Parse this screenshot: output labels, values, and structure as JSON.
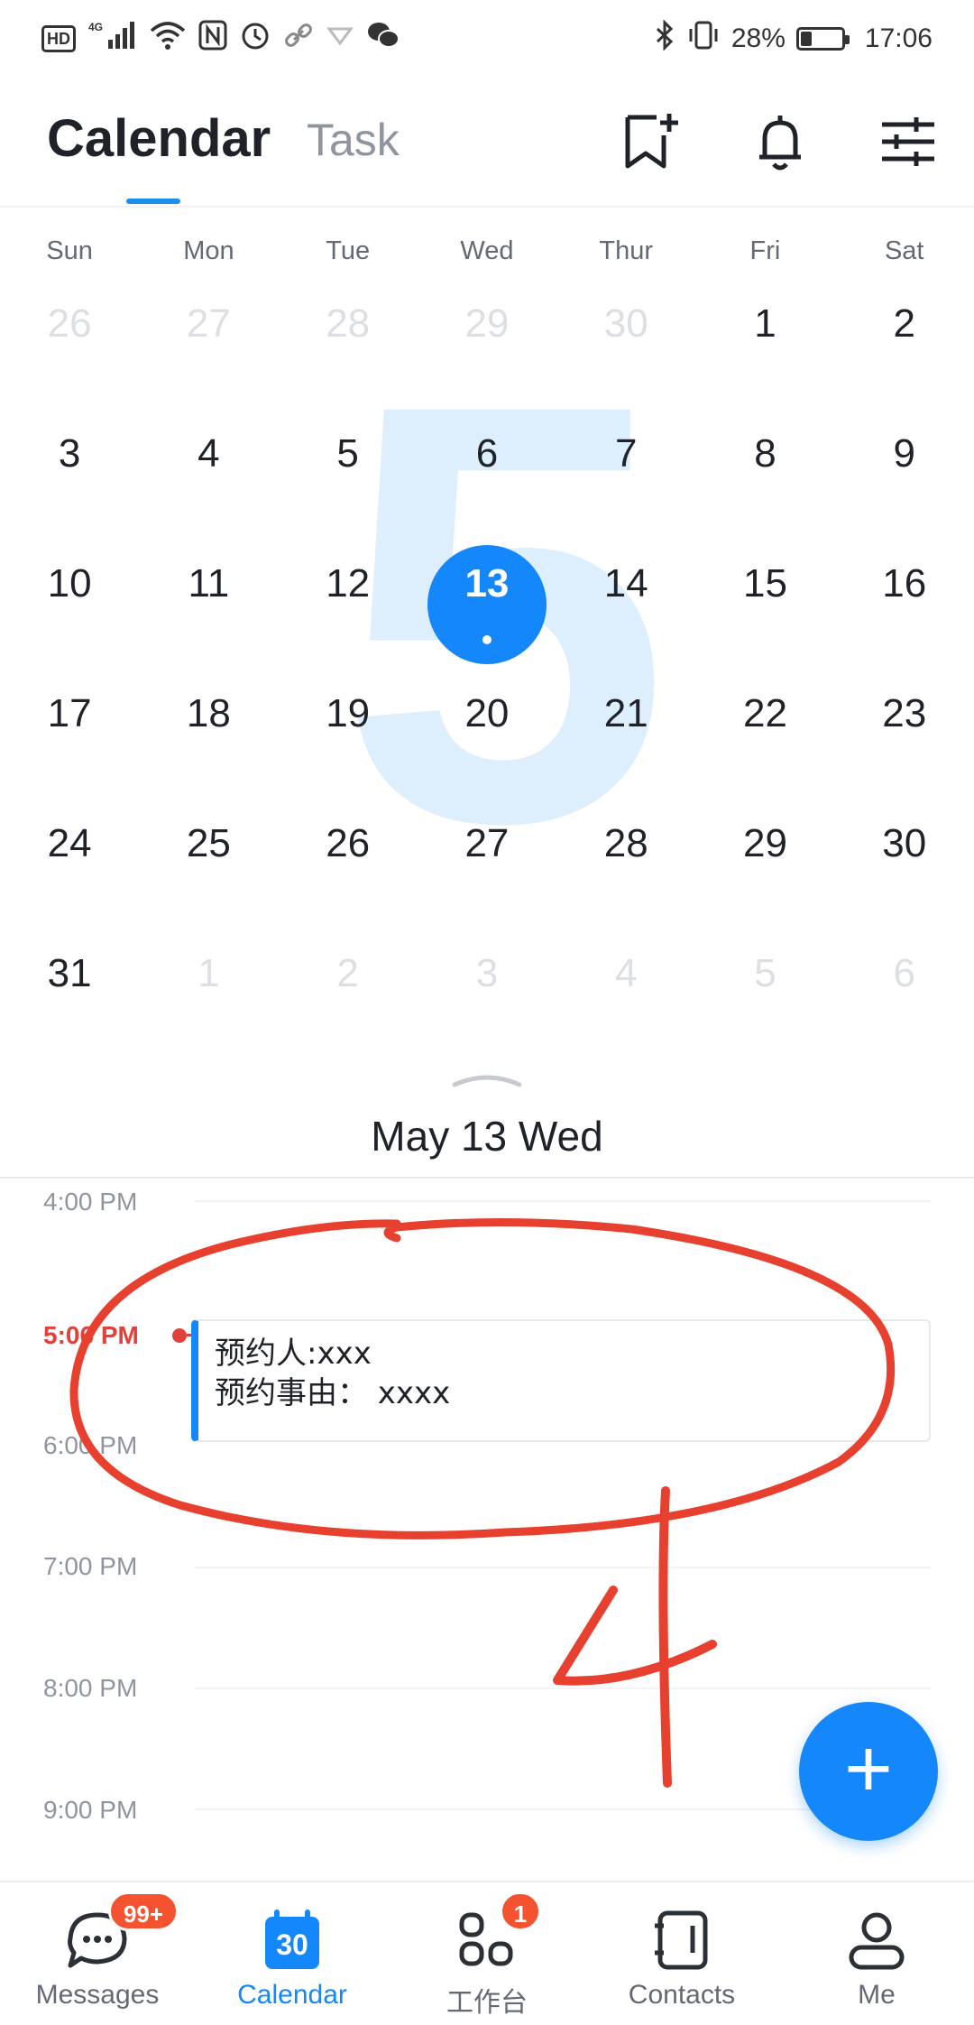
{
  "status_bar": {
    "hd": "HD",
    "network": "4G",
    "battery_percent": "28%",
    "battery_level": 0.28,
    "time": "17:06",
    "icons": [
      "hd-icon",
      "signal-icon",
      "wifi-icon",
      "nfc-icon",
      "alarm-icon",
      "link-icon",
      "vpn-icon",
      "wechat-icon",
      "bluetooth-icon",
      "vibrate-icon",
      "battery-icon"
    ]
  },
  "header": {
    "tabs": [
      {
        "label": "Calendar",
        "active": true
      },
      {
        "label": "Task",
        "active": false
      }
    ],
    "actions": [
      "bookmark-add-icon",
      "bell-icon",
      "filter-sliders-icon"
    ]
  },
  "calendar": {
    "month_watermark": "5",
    "weekdays": [
      "Sun",
      "Mon",
      "Tue",
      "Wed",
      "Thur",
      "Fri",
      "Sat"
    ],
    "weeks": [
      [
        {
          "d": "26",
          "m": true
        },
        {
          "d": "27",
          "m": true
        },
        {
          "d": "28",
          "m": true
        },
        {
          "d": "29",
          "m": true
        },
        {
          "d": "30",
          "m": true
        },
        {
          "d": "1"
        },
        {
          "d": "2"
        }
      ],
      [
        {
          "d": "3"
        },
        {
          "d": "4"
        },
        {
          "d": "5"
        },
        {
          "d": "6"
        },
        {
          "d": "7"
        },
        {
          "d": "8"
        },
        {
          "d": "9"
        }
      ],
      [
        {
          "d": "10"
        },
        {
          "d": "11"
        },
        {
          "d": "12"
        },
        {
          "d": "13",
          "selected": true
        },
        {
          "d": "14"
        },
        {
          "d": "15"
        },
        {
          "d": "16"
        }
      ],
      [
        {
          "d": "17"
        },
        {
          "d": "18"
        },
        {
          "d": "19"
        },
        {
          "d": "20"
        },
        {
          "d": "21"
        },
        {
          "d": "22"
        },
        {
          "d": "23"
        }
      ],
      [
        {
          "d": "24"
        },
        {
          "d": "25"
        },
        {
          "d": "26"
        },
        {
          "d": "27"
        },
        {
          "d": "28"
        },
        {
          "d": "29"
        },
        {
          "d": "30"
        }
      ],
      [
        {
          "d": "31"
        },
        {
          "d": "1",
          "m": true
        },
        {
          "d": "2",
          "m": true
        },
        {
          "d": "3",
          "m": true
        },
        {
          "d": "4",
          "m": true
        },
        {
          "d": "5",
          "m": true
        },
        {
          "d": "6",
          "m": true
        }
      ]
    ],
    "selected_date_label": "May 13 Wed"
  },
  "timeline": {
    "hours": [
      "4:00 PM",
      "6:00 PM",
      "7:00 PM",
      "8:00 PM",
      "9:00 PM"
    ],
    "now_label": "5:06 PM",
    "event": {
      "line1": "预约人:xxx",
      "line2": "预约事由： xxxx"
    },
    "annotation_number": "4"
  },
  "bottom_nav": [
    {
      "label": "Messages",
      "badge": "99+",
      "icon": "chat-icon",
      "active": false
    },
    {
      "label": "Calendar",
      "badge": "",
      "icon": "calendar-30-icon",
      "icon_text": "30",
      "active": true
    },
    {
      "label": "工作台",
      "badge": "1",
      "icon": "apps-grid-icon",
      "active": false
    },
    {
      "label": "Contacts",
      "badge": "",
      "icon": "contacts-book-icon",
      "active": false
    },
    {
      "label": "Me",
      "badge": "",
      "icon": "person-icon",
      "active": false
    }
  ],
  "colors": {
    "accent": "#1487fa",
    "now_red": "#e0413a",
    "annotation_red": "#e8402f",
    "badge": "#f5532f",
    "watermark": "#ddeefc"
  }
}
